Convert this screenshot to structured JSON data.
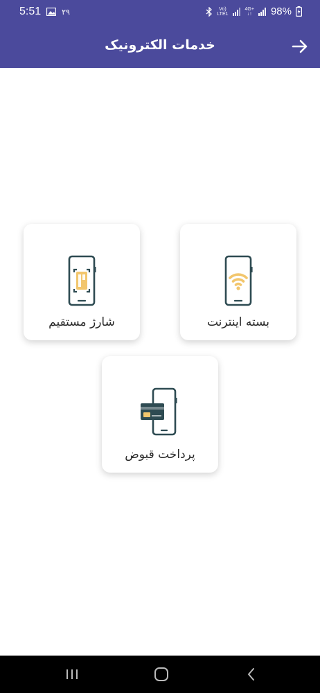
{
  "status": {
    "time": "5:51",
    "date": "۲۹",
    "net_top": "Vo)",
    "net_bottom": "LTE1",
    "net2_top": "4G+",
    "battery": "98%"
  },
  "header": {
    "title": "خدمات الکترونیک"
  },
  "services": [
    {
      "label": "بسته اینترنت"
    },
    {
      "label": "شارژ مستقیم"
    },
    {
      "label": "پرداخت قبوض"
    }
  ],
  "colors": {
    "primary": "#4b4a9c",
    "icon_dark": "#2e4b52",
    "icon_accent": "#f2c66d"
  },
  "icons": {
    "back": "arrow-right-icon",
    "internet": "phone-wifi-icon",
    "charge": "phone-sim-icon",
    "bills": "phone-card-icon"
  }
}
